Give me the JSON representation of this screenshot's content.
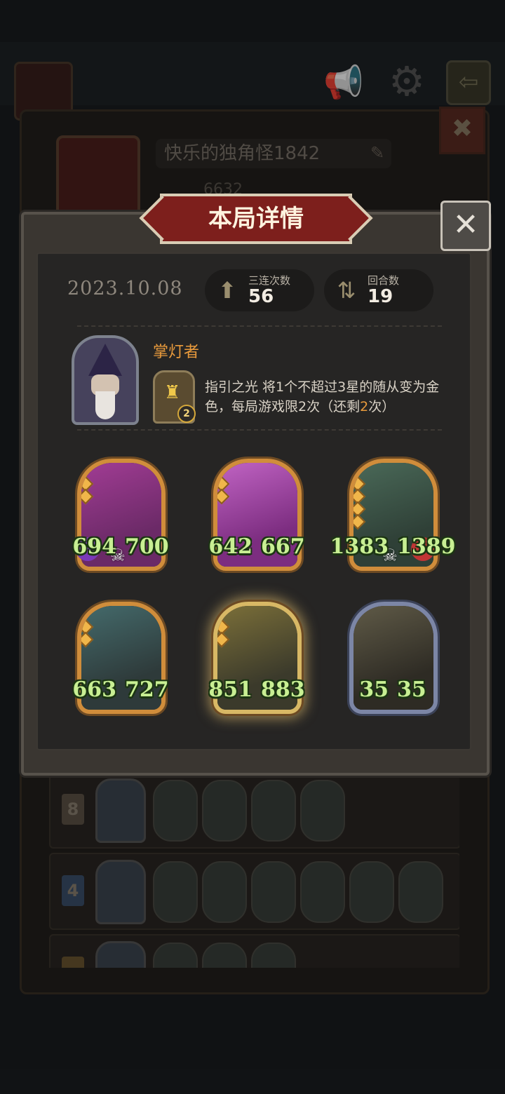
{
  "background": {
    "profile_name": "快乐的独角怪1842",
    "profile_score": "6632",
    "history_rows": [
      {
        "rank": "8"
      },
      {
        "rank": "4"
      },
      {
        "rank": ""
      }
    ],
    "icons": {
      "speaker": "speaker-icon",
      "settings": "gear-icon",
      "exit": "exit-icon",
      "close": "close-icon",
      "edit": "pencil-icon"
    }
  },
  "dialog": {
    "title": "本局详情",
    "close_label": "✕",
    "date": "2023.10.08",
    "stats": [
      {
        "label": "三连次数",
        "value": "56",
        "icon": "triple-icon"
      },
      {
        "label": "回合数",
        "value": "19",
        "icon": "turns-icon"
      }
    ],
    "hero": {
      "name": "掌灯者",
      "power_uses_left": "2",
      "power_text_parts": [
        {
          "text": "指引之光 将1个不超过3星的随从变为金色，每局游戏限2次（还剩",
          "hl": false
        },
        {
          "text": "2",
          "hl": true
        },
        {
          "text": "次）",
          "hl": false
        }
      ]
    },
    "minions": [
      {
        "attack": "694",
        "health": "700",
        "stars": 2,
        "colors": [
          "#6b2a67",
          "#a13c94"
        ],
        "tribe": "#7a39b8",
        "skull": true
      },
      {
        "attack": "642",
        "health": "667",
        "stars": 2,
        "colors": [
          "#7c2d80",
          "#c063c3"
        ],
        "tribe": null,
        "skull": false
      },
      {
        "attack": "1383",
        "health": "1389",
        "stars": 4,
        "colors": [
          "#2f4037",
          "#4a6958"
        ],
        "tribe": "#c23535",
        "skull": true
      },
      {
        "attack": "663",
        "health": "727",
        "stars": 2,
        "colors": [
          "#2e3a3a",
          "#446a6b"
        ],
        "tribe": null,
        "skull": false
      },
      {
        "attack": "851",
        "health": "883",
        "stars": 2,
        "colors": [
          "#3b3a2b",
          "#7b6f39"
        ],
        "tribe": null,
        "skull": false,
        "golden": true
      },
      {
        "attack": "35",
        "health": "35",
        "stars": 0,
        "colors": [
          "#2e2b24",
          "#5f5a47"
        ],
        "tribe": null,
        "skull": false,
        "silver": true
      }
    ]
  }
}
